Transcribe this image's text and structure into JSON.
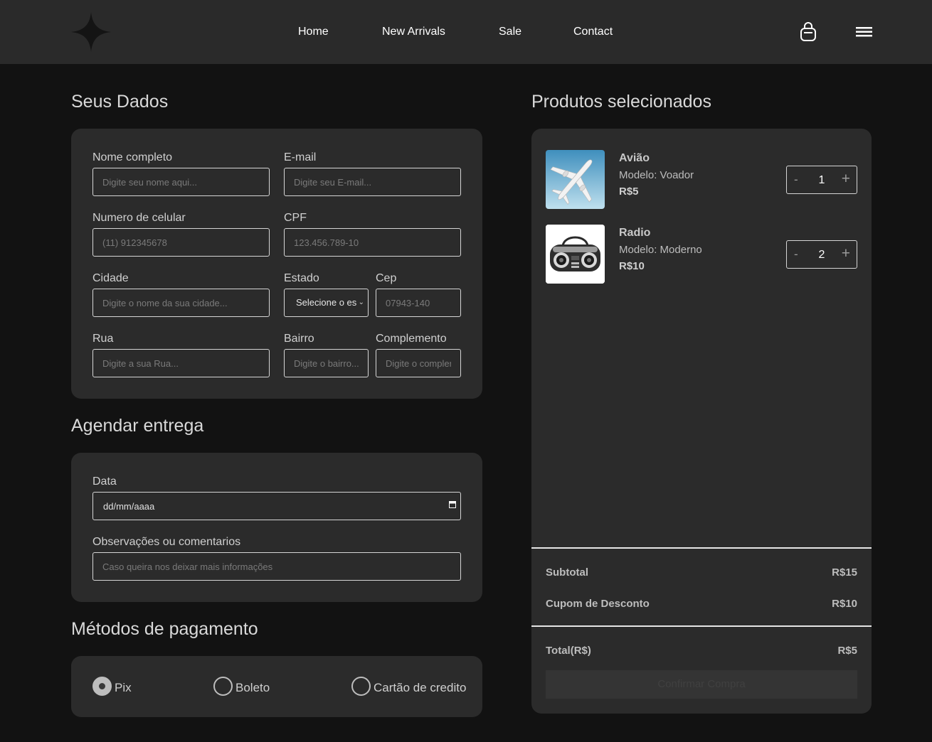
{
  "nav": {
    "links": [
      "Home",
      "New Arrivals",
      "Sale",
      "Contact"
    ]
  },
  "dados": {
    "title": "Seus Dados",
    "nome_label": "Nome completo",
    "nome_placeholder": "Digite seu nome aqui...",
    "email_label": "E-mail",
    "email_placeholder": "Digite seu E-mail...",
    "celular_label": "Numero de celular",
    "celular_placeholder": "(11) 912345678",
    "cpf_label": "CPF",
    "cpf_placeholder": "123.456.789-10",
    "cidade_label": "Cidade",
    "cidade_placeholder": "Digite o nome da sua cidade...",
    "estado_label": "Estado",
    "estado_value": "Selecione o es",
    "cep_label": "Cep",
    "cep_placeholder": "07943-140",
    "rua_label": "Rua",
    "rua_placeholder": "Digite a sua Rua...",
    "bairro_label": "Bairro",
    "bairro_placeholder": "Digite o bairro...",
    "complemento_label": "Complemento",
    "complemento_placeholder": "Digite o complem"
  },
  "entrega": {
    "title": "Agendar entrega",
    "data_label": "Data",
    "data_value": "dd/mm/aaaa",
    "obs_label": "Observações ou comentarios",
    "obs_placeholder": "Caso queira nos deixar mais informações"
  },
  "pagamento": {
    "title": "Métodos de pagamento",
    "options": [
      "Pix",
      "Boleto",
      "Cartão de credito"
    ],
    "selected": "Pix"
  },
  "produtos": {
    "title": "Produtos selecionados",
    "items": [
      {
        "name": "Avião",
        "model_label": "Modelo:",
        "model": "Voador",
        "price": "R$5",
        "qty": "1"
      },
      {
        "name": "Radio",
        "model_label": "Modelo:",
        "model": "Moderno",
        "price": "R$10",
        "qty": "2"
      }
    ],
    "qty_minus": "-",
    "qty_plus": "+"
  },
  "resumo": {
    "subtotal_label": "Subtotal",
    "subtotal_value": "R$15",
    "cupom_label": "Cupom de Desconto",
    "cupom_value": "R$10",
    "total_label": "Total(R$)",
    "total_value": "R$5",
    "confirm_label": "Confirmar Compra"
  },
  "colors": {
    "background": "#121212",
    "topbar": "#2a2a2a",
    "card": "#2b2b2b",
    "border": "#d6d6d6"
  }
}
